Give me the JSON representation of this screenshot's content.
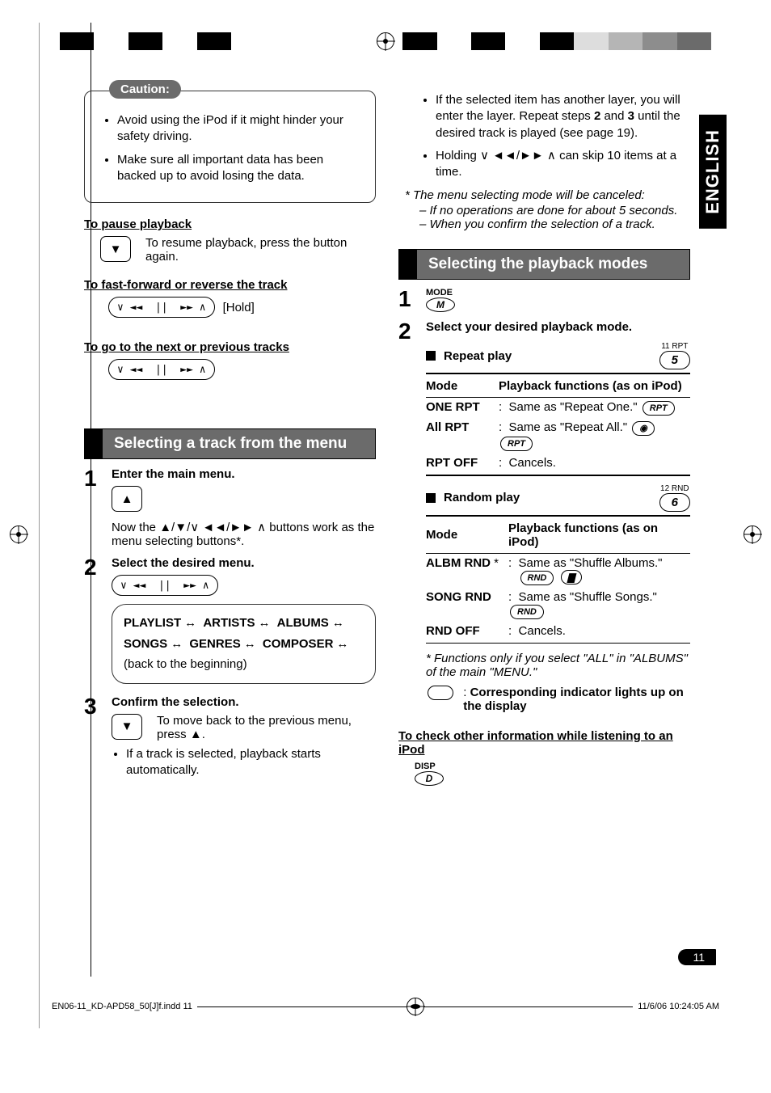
{
  "english_tab": "ENGLISH",
  "page_number": "11",
  "footer_left": "EN06-11_KD-APD58_50[J]f.indd   11",
  "footer_right": "11/6/06   10:24:05 AM",
  "caution": {
    "badge": "Caution:",
    "items": [
      "Avoid using the iPod if it might hinder your safety driving.",
      "Make sure all important data has been backed up to avoid losing the data."
    ]
  },
  "left": {
    "pause_head": "To pause playback",
    "pause_text": "To resume playback, press the button again.",
    "fwd_head": "To fast-forward or reverse the track",
    "fwd_hold": "[Hold]",
    "next_head": "To go to the next or previous tracks",
    "select_track_title": "Selecting a track from the menu",
    "step1": "Enter the main menu.",
    "step1_note_a": "Now the ",
    "step1_note_b": " buttons work as the menu selecting buttons*.",
    "step2": "Select the desired menu.",
    "menu_chain": {
      "items": [
        "PLAYLIST",
        "ARTISTS",
        "ALBUMS",
        "SONGS",
        "GENRES",
        "COMPOSER"
      ],
      "tail": "(back to the beginning)"
    },
    "step3": "Confirm the selection.",
    "step3_body": "To move back to the previous menu, press ▲.",
    "step3_bullet": "If a track is selected, playback starts automatically."
  },
  "right": {
    "cont_items": [
      {
        "pre": "If the selected item has another layer, you will enter the layer. Repeat steps ",
        "b1": "2",
        "mid": " and ",
        "b2": "3",
        "post": " until the desired track is played (see page 19)."
      },
      {
        "holding": "Holding ",
        "tail": " can skip 10 items at a time."
      }
    ],
    "star_lead": "*  The menu selecting mode will be canceled:",
    "star_items": [
      "If no operations are done for about 5 seconds.",
      "When you confirm the selection of a track."
    ],
    "playback_title": "Selecting the playback modes",
    "step1_label": "MODE",
    "step1_btn": "M",
    "step2": "Select your desired playback mode.",
    "repeat_head": "Repeat play",
    "repeat_badge_top": "11  RPT",
    "repeat_badge_num": "5",
    "table_head_mode": "Mode",
    "table_head_func": "Playback functions (as on iPod)",
    "repeat_rows": [
      {
        "mode": "ONE RPT",
        "desc": "Same as \"Repeat One.\"",
        "ind": [
          "RPT"
        ]
      },
      {
        "mode": "All RPT",
        "desc": "Same as \"Repeat All.\"",
        "ind": [
          "disc",
          "RPT"
        ]
      },
      {
        "mode": "RPT OFF",
        "desc": "Cancels.",
        "ind": []
      }
    ],
    "random_head": "Random play",
    "random_badge_top": "12  RND",
    "random_badge_num": "6",
    "random_rows": [
      {
        "mode": "ALBM RND",
        "star": true,
        "desc": "Same as \"Shuffle Albums.\"",
        "ind": [
          "RND",
          "folder"
        ]
      },
      {
        "mode": "SONG RND",
        "desc": "Same as \"Shuffle Songs.\"",
        "ind": [
          "RND"
        ]
      },
      {
        "mode": "RND OFF",
        "desc": "Cancels.",
        "ind": []
      }
    ],
    "random_foot": "*  Functions only if you select \"ALL\" in \"ALBUMS\" of the main \"MENU.\"",
    "indicator_note": "Corresponding indicator lights up on the display",
    "check_info": "To check other information while listening to an iPod",
    "disp_label": "DISP",
    "disp_btn": "D"
  }
}
